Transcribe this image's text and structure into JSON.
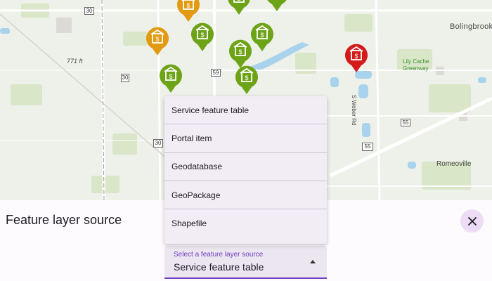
{
  "map": {
    "labels": {
      "elevation": "771 ft",
      "place_bolingbrook": "Bolingbrook",
      "park": "Lily Cache\nGreenway",
      "road_weber": "S Weber Rd",
      "place_romeoville": "Romeoville"
    },
    "route_shields": [
      "30",
      "30",
      "59",
      "30",
      "55",
      "55"
    ],
    "pins": [
      {
        "name": "orange",
        "color": "#e29a12",
        "icon": "building-icon"
      },
      {
        "name": "green",
        "color": "#6da317",
        "icon": "building-icon"
      },
      {
        "name": "red",
        "color": "#d51a1a",
        "icon": "building-icon"
      }
    ],
    "colors": {
      "water": "#a9d3ec",
      "parks": "#cfe1b6",
      "roads": "#ffffff"
    }
  },
  "panel": {
    "title": "Feature layer source",
    "close_icon": "close-icon"
  },
  "dropdown": {
    "label": "Select a feature layer source",
    "value": "Service feature table",
    "options": [
      "Service feature table",
      "Portal item",
      "Geodatabase",
      "GeoPackage",
      "Shapefile"
    ],
    "accent": "#6e3fc0"
  }
}
